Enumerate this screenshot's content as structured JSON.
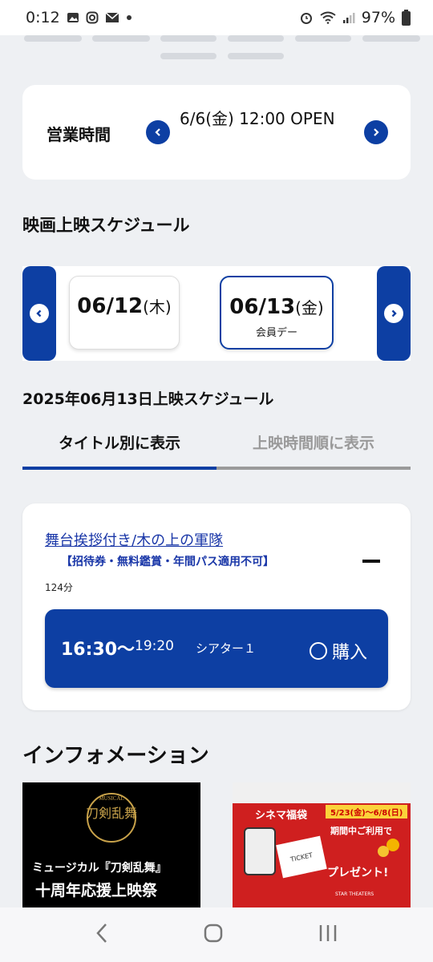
{
  "status_bar": {
    "time": "0:12",
    "battery": "97%"
  },
  "business_hours": {
    "label": "営業時間",
    "text": "6/6(金) 12:00 OPEN"
  },
  "schedule": {
    "section_title": "映画上映スケジュール",
    "dates": [
      {
        "date": "06/12",
        "dow": "(木)",
        "note": ""
      },
      {
        "date": "06/13",
        "dow": "(金)",
        "note": "会員デー"
      }
    ],
    "selected_index": 1,
    "day_heading": "2025年06月13日上映スケジュール"
  },
  "tabs": [
    {
      "label": "タイトル別に表示",
      "active": true
    },
    {
      "label": "上映時間順に表示",
      "active": false
    }
  ],
  "movie": {
    "title": "舞台挨拶付き/木の上の軍隊",
    "note": "【招待券・無料鑑賞・年間パス適用不可】",
    "duration": "124分",
    "showtimes": [
      {
        "start": "16:30〜",
        "end": "19:20",
        "theater": "シアター１",
        "buy_label": "購入"
      }
    ]
  },
  "information": {
    "title": "インフォメーション",
    "banners": [
      {
        "logo_top": "MUSICAL",
        "logo_main": "刀剣乱舞",
        "line1": "ミュージカル『刀剣乱舞』",
        "line2": "十周年応援上映祭"
      },
      {
        "title": "シネマ福袋",
        "dates": "5/23(金)～6/8(日)",
        "line1": "期間中ご利用で",
        "line2": "プレゼント!",
        "brand": "STAR THEATERS",
        "ticket": "TICKET"
      }
    ]
  },
  "colors": {
    "primary": "#0d3fa3",
    "link": "#1a37a8",
    "background": "#eef0f3",
    "banner_red": "#cf1f1f"
  }
}
